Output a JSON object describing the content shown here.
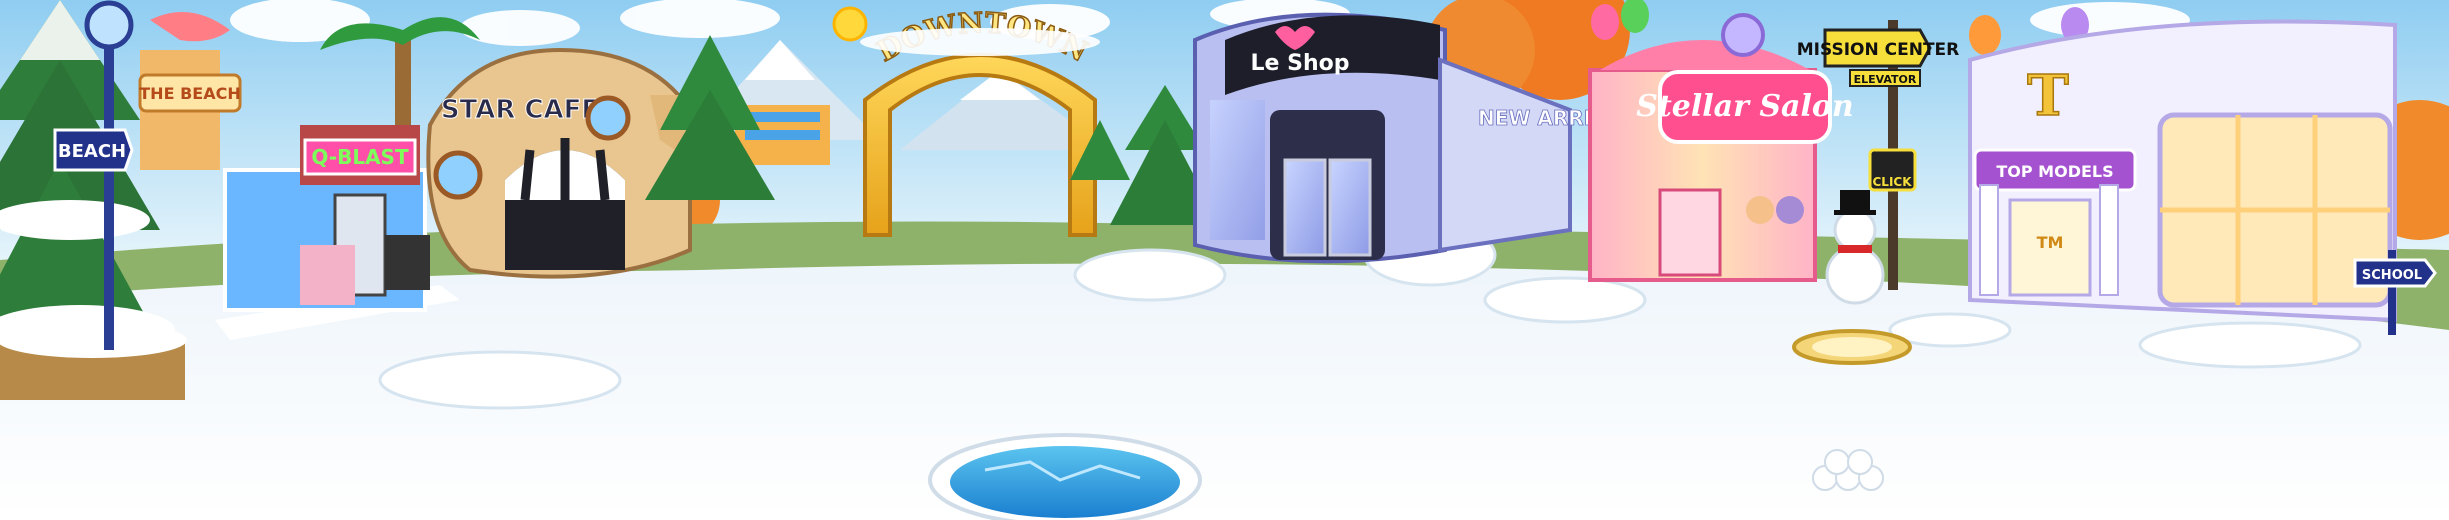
{
  "scene": {
    "area": "downtown",
    "signs": {
      "downtown": "DOWNTOWN",
      "beach_sign": "BEACH",
      "the_beach": "THE BEACH",
      "star_cafe": "STAR CAFE",
      "q_blast": "Q-BLAST",
      "le_shop": "Le Shop",
      "new_arrivals": "NEW ARRIVALS",
      "stellar_salon": "Stellar Salon",
      "mission_center": "MISSION CENTER",
      "elevator": "ELEVATOR",
      "click": "CLICK",
      "top_models": "TOP MODELS",
      "tm": "TM",
      "school": "SCHOOL",
      "top_models_initial": "T"
    }
  }
}
